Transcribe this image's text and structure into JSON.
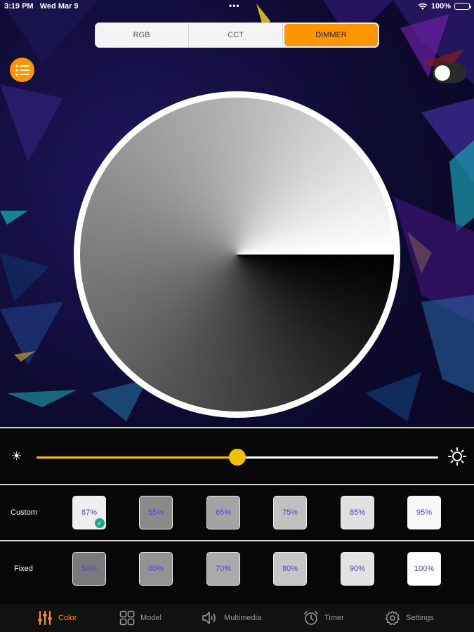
{
  "status_bar": {
    "time": "3:19 PM",
    "date": "Wed Mar 9",
    "battery": "100%",
    "dots": "•••"
  },
  "mode_tabs": [
    {
      "label": "RGB",
      "active": false
    },
    {
      "label": "CCT",
      "active": false
    },
    {
      "label": "DIMMER",
      "active": true
    }
  ],
  "power_toggle": {
    "on": false
  },
  "brightness_slider": {
    "value_fraction": 0.5
  },
  "custom_row": {
    "label": "Custom",
    "swatches": [
      {
        "label": "87%",
        "gray": "#efefef",
        "selected": true
      },
      {
        "label": "55%",
        "gray": "#8a8a8a",
        "selected": false
      },
      {
        "label": "65%",
        "gray": "#a4a4a4",
        "selected": false
      },
      {
        "label": "75%",
        "gray": "#c0c0c0",
        "selected": false
      },
      {
        "label": "85%",
        "gray": "#e0e0e0",
        "selected": false
      },
      {
        "label": "95%",
        "gray": "#f8f8f8",
        "selected": false
      }
    ]
  },
  "fixed_row": {
    "label": "Fixed",
    "swatches": [
      {
        "label": "50%",
        "gray": "#7a7a7a"
      },
      {
        "label": "60%",
        "gray": "#939393"
      },
      {
        "label": "70%",
        "gray": "#ababab"
      },
      {
        "label": "80%",
        "gray": "#c6c6c6"
      },
      {
        "label": "90%",
        "gray": "#e2e2e2"
      },
      {
        "label": "100%",
        "gray": "#ffffff"
      }
    ]
  },
  "tabbar": [
    {
      "label": "Color",
      "icon": "sliders-icon",
      "active": true
    },
    {
      "label": "Model",
      "icon": "grid-icon",
      "active": false
    },
    {
      "label": "Multimedia",
      "icon": "speaker-icon",
      "active": false
    },
    {
      "label": "Timer",
      "icon": "alarm-clock-icon",
      "active": false
    },
    {
      "label": "Settings",
      "icon": "gear-icon",
      "active": false
    }
  ],
  "colors": {
    "accent": "#ff9500",
    "slider": "#f2c200",
    "check": "#1aa88a"
  }
}
